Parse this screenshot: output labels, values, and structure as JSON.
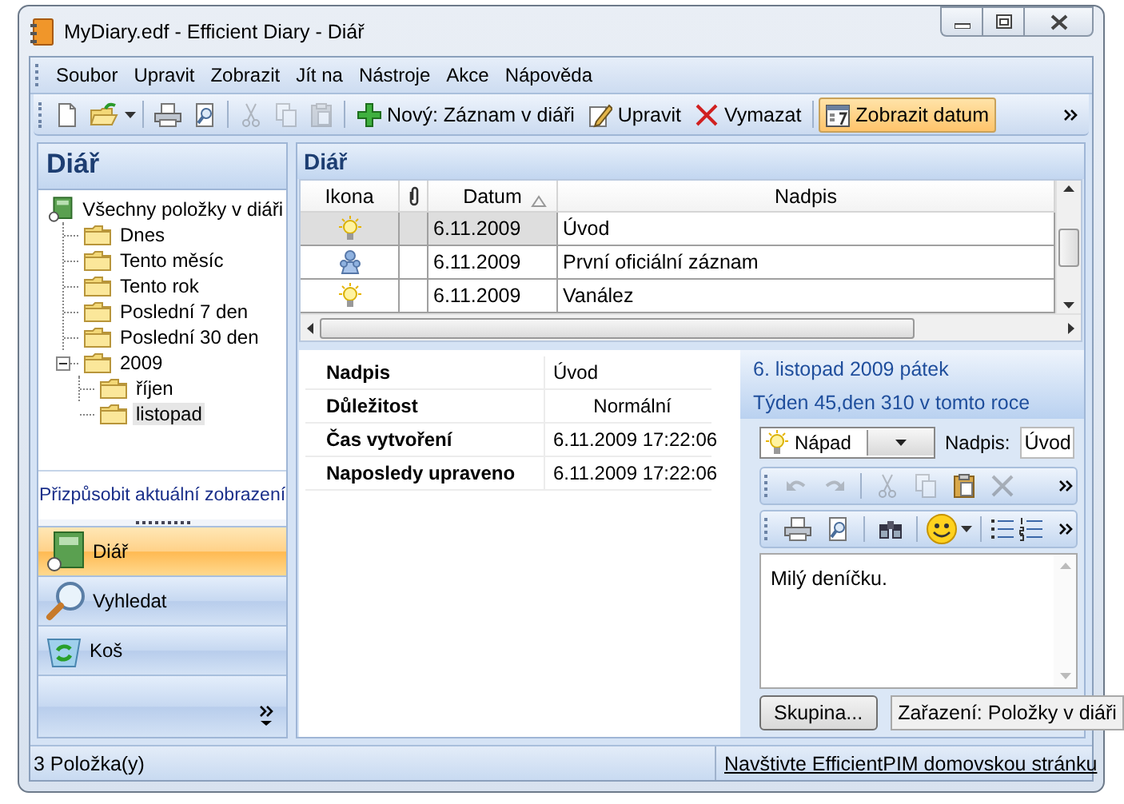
{
  "window": {
    "title": "MyDiary.edf - Efficient Diary - Diář"
  },
  "menu": [
    "Soubor",
    "Upravit",
    "Zobrazit",
    "Jít na",
    "Nástroje",
    "Akce",
    "Nápověda"
  ],
  "toolbar": {
    "tools": [
      {
        "disabled": false
      },
      {
        "disabled": false
      },
      {
        "disabled": false
      },
      {
        "disabled": false
      },
      {
        "disabled": true
      },
      {
        "disabled": true
      },
      {
        "disabled": true
      }
    ],
    "buttons": [
      {
        "label": "Nový: Záznam v diáři",
        "pressed": false
      },
      {
        "label": "Upravit",
        "pressed": false
      },
      {
        "label": "Vymazat",
        "pressed": false
      },
      {
        "label": "Zobrazit datum",
        "pressed": true
      }
    ]
  },
  "sidebar": {
    "title": "Diář",
    "tree": [
      {
        "label": "Všechny položky v diáři",
        "selected": false,
        "children": [
          {
            "label": "Dnes",
            "selected": false
          },
          {
            "label": "Tento měsíc",
            "selected": false
          },
          {
            "label": "Tento rok",
            "selected": false
          },
          {
            "label": "Poslední 7 den",
            "selected": false
          },
          {
            "label": "Poslední 30 den",
            "selected": false
          },
          {
            "label": "2009",
            "selected": false,
            "expanded": true,
            "children": [
              {
                "label": "říjen",
                "selected": false
              },
              {
                "label": "listopad",
                "selected": true
              }
            ]
          }
        ]
      }
    ],
    "customize_link": "Přizpůsobit aktuální zobrazení",
    "nav_buttons": [
      {
        "label": "Diář",
        "selected": true
      },
      {
        "label": "Vyhledat",
        "selected": false
      },
      {
        "label": "Koš",
        "selected": false
      }
    ]
  },
  "grid": {
    "title": "Diář",
    "columns": [
      {
        "kind": "text",
        "label": "Ikona",
        "sorted": false
      },
      {
        "kind": "attachment",
        "sorted": false
      },
      {
        "kind": "text",
        "label": "Datum",
        "sorted": true
      },
      {
        "kind": "text",
        "label": "Nadpis",
        "sorted": false
      }
    ],
    "rows": [
      {
        "kind": "idea",
        "date": "6.11.2009",
        "title": "Úvod",
        "selected": true
      },
      {
        "kind": "people",
        "date": "6.11.2009",
        "title": "První oficiální záznam",
        "selected": false
      },
      {
        "kind": "idea",
        "date": "6.11.2009",
        "title": "Vanález",
        "selected": false
      }
    ]
  },
  "properties": [
    {
      "kind": "text",
      "label": "Nadpis",
      "value": "Úvod"
    },
    {
      "kind": "choice",
      "label": "Důležitost",
      "value": "Normální"
    },
    {
      "kind": "text",
      "label": "Čas vytvoření",
      "value": "6.11.2009 17:22:06"
    },
    {
      "kind": "text",
      "label": "Naposledy upraveno",
      "value": "6.11.2009 17:22:06"
    }
  ],
  "editor": {
    "date": "6. listopad 2009 pátek",
    "week": "Týden 45,den 310 v tomto roce",
    "category": "Nápad",
    "title_label": "Nadpis:",
    "title_value": "Úvod",
    "toolbar_1": [
      {
        "disabled": true
      },
      {
        "disabled": true
      },
      {
        "disabled": true
      },
      {
        "disabled": true
      },
      {
        "disabled": false
      },
      {
        "disabled": true
      }
    ],
    "body": "Milý deníčku.",
    "group_button": "Skupina...",
    "filed_in": "Zařazení: Položky v diáři"
  },
  "status_bar": {
    "count": "3 Položka(y)",
    "link": "Navštivte EfficientPIM domovskou stránku"
  }
}
